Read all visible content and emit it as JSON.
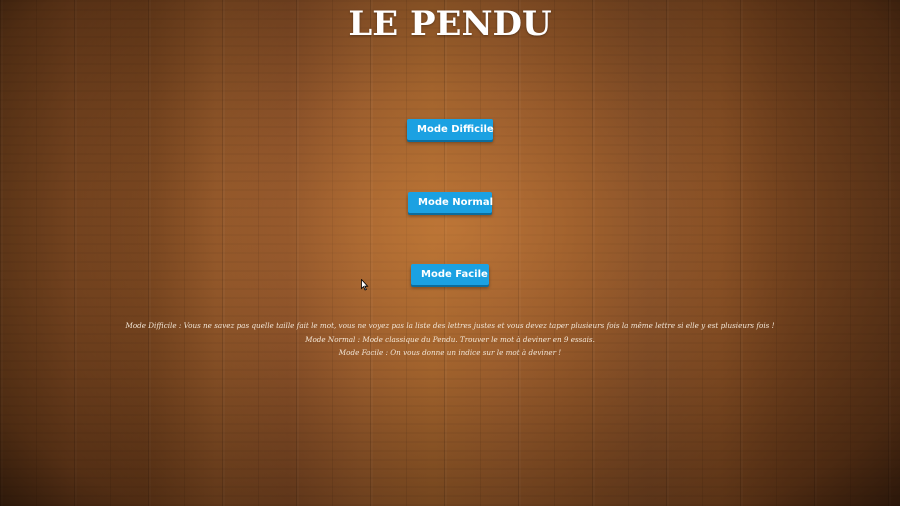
{
  "title": "LE PENDU",
  "buttons": {
    "hard": "Mode Difficile",
    "normal": "Mode Normal",
    "easy": "Mode Facile"
  },
  "descriptions": [
    "Mode Difficile : Vous ne savez pas quelle taille fait le mot, vous ne voyez pas la liste des lettres justes et vous devez taper plusieurs fois la même lettre si elle y est plusieurs fois !",
    "Mode Normal : Mode classique du Pendu. Trouver le mot à deviner en 9 essais.",
    "Mode Facile : On vous donne un indice sur le mot à deviner !"
  ],
  "colors": {
    "button_bg": "#1ba1e2",
    "button_text": "#ffffff",
    "title_text": "#ffffff",
    "description_text": "#f3e6d6",
    "background": "wood-brown"
  },
  "icons": {
    "cursor": "mouse-pointer-icon"
  }
}
